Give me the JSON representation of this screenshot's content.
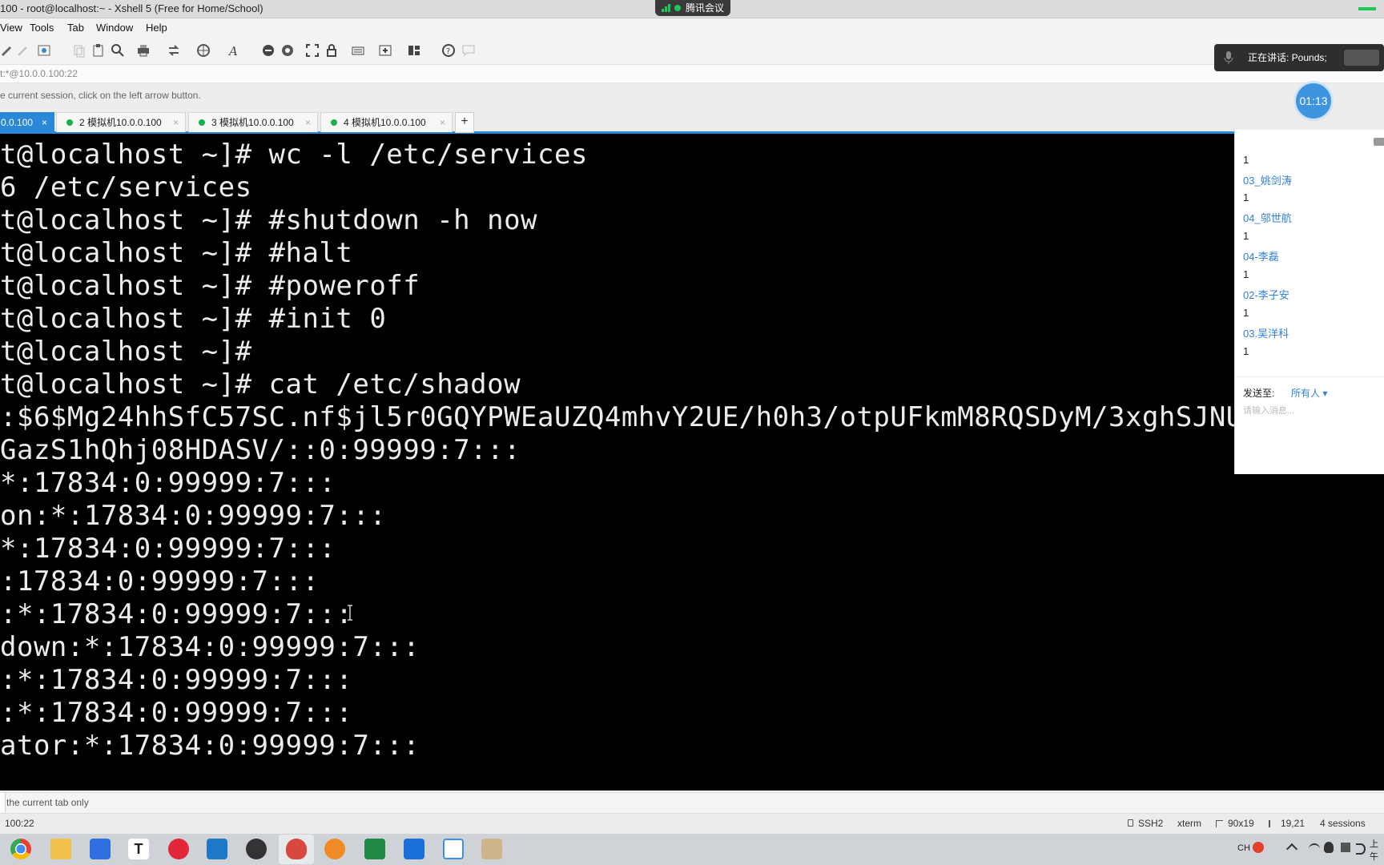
{
  "window": {
    "title": "100 - root@localhost:~ - Xshell 5 (Free for Home/School)",
    "meeting_app": "腾讯会议"
  },
  "menu": [
    "View",
    "Tools",
    "Tab",
    "Window",
    "Help"
  ],
  "address": "t:*@10.0.0.100:22",
  "info_text": "e current session, click on the left arrow button.",
  "tabs": [
    {
      "label": "0.0.100",
      "active": true
    },
    {
      "label": "2 模拟机10.0.0.100",
      "active": false
    },
    {
      "label": "3 模拟机10.0.0.100",
      "active": false
    },
    {
      "label": "4 模拟机10.0.0.100",
      "active": false
    }
  ],
  "tab_close": "×",
  "tab_add": "+",
  "terminal": {
    "lines": [
      "t@localhost ~]# wc -l /etc/services",
      "6 /etc/services",
      "t@localhost ~]# #shutdown -h now",
      "t@localhost ~]# #halt",
      "t@localhost ~]# #poweroff",
      "t@localhost ~]# #init 0",
      "t@localhost ~]#",
      "t@localhost ~]# cat /etc/shadow",
      ":$6$Mg24hhSfC57SC.nf$jl5r0GQYPWEaUZQ4mhvY2UE/h0h3/otpUFkmM8RQSDyM/3xghSJNU",
      "GazS1hQhj08HDASV/::0:99999:7:::",
      "*:17834:0:99999:7:::",
      "on:*:17834:0:99999:7:::",
      "*:17834:0:99999:7:::",
      ":17834:0:99999:7:::",
      ":*:17834:0:99999:7:::",
      "down:*:17834:0:99999:7:::",
      ":*:17834:0:99999:7:::",
      ":*:17834:0:99999:7:::",
      "ator:*:17834:0:99999:7:::"
    ]
  },
  "chat": {
    "items": [
      {
        "text": "1",
        "type": "msg"
      },
      {
        "text": "03_姚剑涛",
        "type": "name"
      },
      {
        "text": "1",
        "type": "msg"
      },
      {
        "text": "04_邬世航",
        "type": "name"
      },
      {
        "text": "1",
        "type": "msg"
      },
      {
        "text": "04-李磊",
        "type": "name"
      },
      {
        "text": "1",
        "type": "msg"
      },
      {
        "text": "02-李子安",
        "type": "name"
      },
      {
        "text": "1",
        "type": "msg"
      },
      {
        "text": "03.吴洋科",
        "type": "name"
      },
      {
        "text": "1",
        "type": "msg"
      }
    ],
    "send_to_label": "发送至:",
    "send_to_value": "所有人 ▾",
    "input_placeholder": "请输入消息..."
  },
  "speaking": "正在讲话: Pounds;",
  "timer": "01:13",
  "status_hint": "the current tab only",
  "statusbar": {
    "host": "100:22",
    "protocol": "SSH2",
    "term": "xterm",
    "size": "90x19",
    "cursor": "19,21",
    "sessions": "4 sessions"
  },
  "taskbar": {
    "apps": [
      "chrome-icon",
      "file-explorer-icon",
      "feishu-icon",
      "typora-icon",
      "netease-music-icon",
      "virtualbox-icon",
      "xmind-icon",
      "xshell-icon",
      "settings-icon",
      "excel-icon",
      "mail-icon",
      "meeting-icon",
      "paint-icon"
    ],
    "tray_lang": "CH",
    "tray_time": "上午"
  },
  "colors": {
    "accent": "#2b88d8",
    "terminal_bg": "#000000",
    "terminal_fg": "#ececec",
    "online": "#16b14a"
  }
}
